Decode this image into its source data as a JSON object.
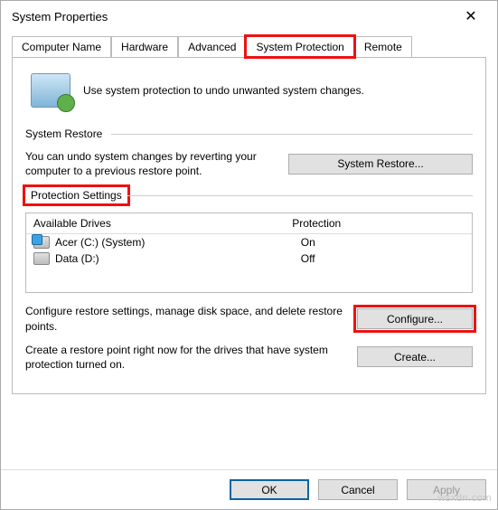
{
  "window": {
    "title": "System Properties",
    "close_glyph": "✕"
  },
  "tabs": [
    {
      "label": "Computer Name"
    },
    {
      "label": "Hardware"
    },
    {
      "label": "Advanced"
    },
    {
      "label": "System Protection"
    },
    {
      "label": "Remote"
    }
  ],
  "intro_text": "Use system protection to undo unwanted system changes.",
  "section_restore": {
    "title": "System Restore",
    "desc": "You can undo system changes by reverting your computer to a previous restore point.",
    "button": "System Restore..."
  },
  "section_protection": {
    "title": "Protection Settings",
    "col_drive": "Available Drives",
    "col_prot": "Protection",
    "drives": [
      {
        "name": "Acer (C:) (System)",
        "protection": "On",
        "system": true
      },
      {
        "name": "Data (D:)",
        "protection": "Off",
        "system": false
      }
    ],
    "configure_desc": "Configure restore settings, manage disk space, and delete restore points.",
    "configure_btn": "Configure...",
    "create_desc": "Create a restore point right now for the drives that have system protection turned on.",
    "create_btn": "Create..."
  },
  "footer": {
    "ok": "OK",
    "cancel": "Cancel",
    "apply": "Apply"
  },
  "watermark": "wsxdn.com"
}
